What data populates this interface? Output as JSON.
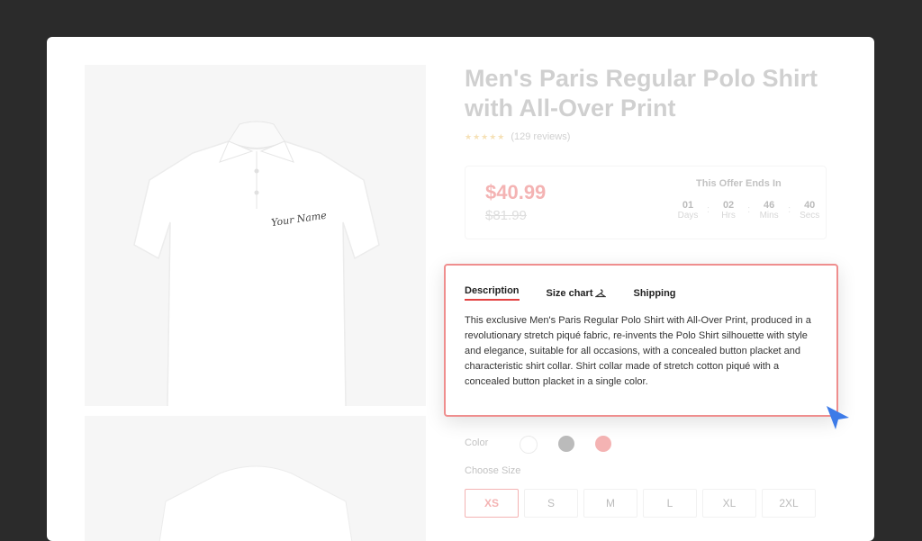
{
  "product": {
    "title": "Men's Paris Regular Polo Shirt with All-Over Print",
    "reviews": "(129 reviews)",
    "stars": "★★★★★",
    "signature_text": "Your Name"
  },
  "pricing": {
    "price": "$40.99",
    "old_price": "$81.99",
    "offer_label": "This Offer Ends In",
    "timer": [
      {
        "value": "01",
        "unit": "Days"
      },
      {
        "value": "02",
        "unit": "Hrs"
      },
      {
        "value": "46",
        "unit": "Mins"
      },
      {
        "value": "40",
        "unit": "Secs"
      }
    ]
  },
  "tabs": {
    "description": "Description",
    "size_chart": "Size chart",
    "shipping": "Shipping",
    "active": "Description"
  },
  "description_text": "This exclusive Men's Paris Regular Polo Shirt with All-Over Print, produced in a revolutionary stretch piqué fabric, re-invents the Polo Shirt silhouette with style and elegance, suitable for all occasions, with a concealed button placket and characteristic shirt collar. Shirt collar made of stretch cotton piqué with a concealed button placket in a single color.",
  "color": {
    "label": "Color",
    "swatches": [
      "#ffffff",
      "#555555",
      "#e34242"
    ]
  },
  "size": {
    "label": "Choose Size",
    "options": [
      "XS",
      "S",
      "M",
      "L",
      "XL",
      "2XL"
    ],
    "selected": "XS"
  },
  "colors": {
    "accent": "#e34242",
    "background": "#2b2b2b",
    "cursor": "#3d7be8"
  }
}
